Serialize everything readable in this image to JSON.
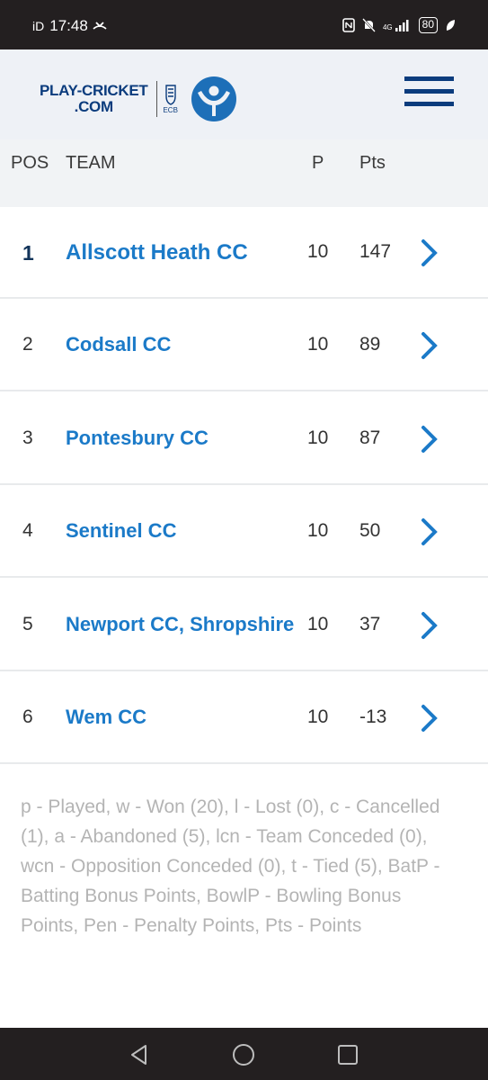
{
  "status_bar": {
    "carrier_id": "iD",
    "time": "17:48",
    "network": "4G",
    "battery": "80"
  },
  "header": {
    "logo_line1": "PLAY-CRICKET",
    "logo_line2": ".COM",
    "ecb_text": "ECB",
    "menu_icon": "hamburger-menu-icon"
  },
  "table": {
    "columns": {
      "pos": "POS",
      "team": "TEAM",
      "played": "P",
      "pts": "Pts"
    },
    "rows": [
      {
        "pos": "1",
        "team": "Allscott Heath CC",
        "played": "10",
        "pts": "147"
      },
      {
        "pos": "2",
        "team": "Codsall CC",
        "played": "10",
        "pts": "89"
      },
      {
        "pos": "3",
        "team": "Pontesbury CC",
        "played": "10",
        "pts": "87"
      },
      {
        "pos": "4",
        "team": "Sentinel CC",
        "played": "10",
        "pts": "50"
      },
      {
        "pos": "5",
        "team": "Newport CC, Shropshire",
        "played": "10",
        "pts": "37"
      },
      {
        "pos": "6",
        "team": "Wem CC",
        "played": "10",
        "pts": "-13"
      }
    ]
  },
  "legend": "p - Played, w - Won (20), l - Lost (0), c - Cancelled (1), a - Abandoned (5), lcn - Team Conceded (0), wcn - Opposition Conceded (0), t - Tied (5), BatP - Batting Bonus Points, BowlP - Bowling Bonus Points, Pen - Penalty Points, Pts - Points",
  "colors": {
    "brand_navy": "#0b3c7d",
    "link_blue": "#1b7ac8",
    "header_bg": "#eef1f6"
  }
}
